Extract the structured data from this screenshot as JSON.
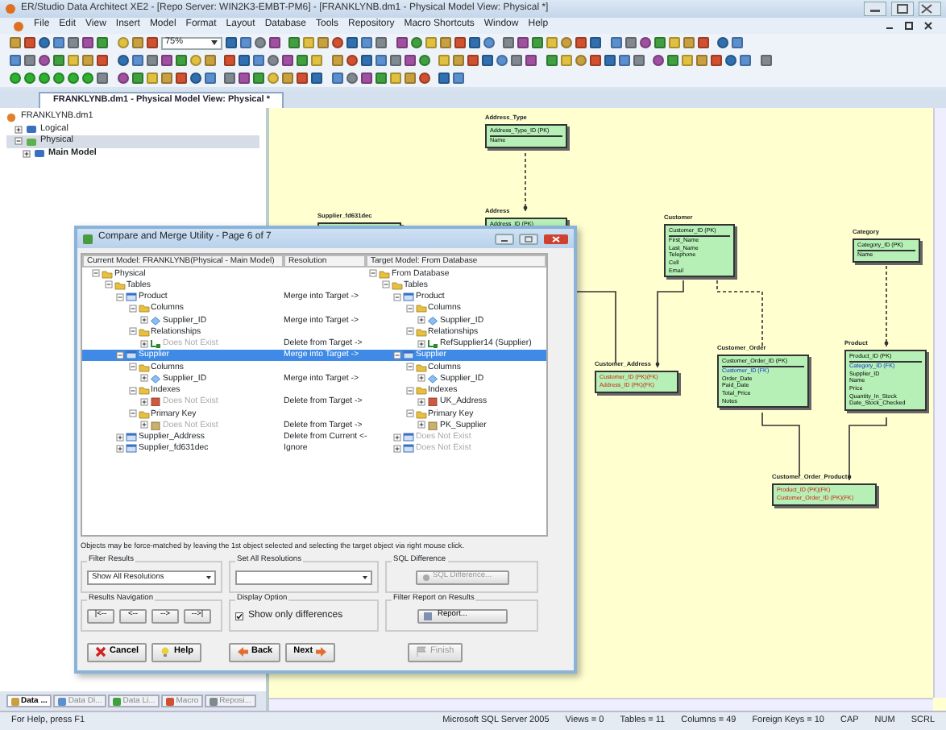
{
  "window": {
    "title": "ER/Studio Data Architect XE2 - [Repo Server: WIN2K3-EMBT-PM6] - [FRANKLYNB.dm1 - Physical Model View: Physical *]"
  },
  "menu": [
    "File",
    "Edit",
    "View",
    "Insert",
    "Model",
    "Format",
    "Layout",
    "Database",
    "Tools",
    "Repository",
    "Macro Shortcuts",
    "Window",
    "Help"
  ],
  "toolbar": {
    "zoom": "75%"
  },
  "document_tab": {
    "label": "FRANKLYNB.dm1 - Physical Model View: Physical *",
    "selected": true
  },
  "explorer": {
    "tree": [
      {
        "label": "FRANKLYNB.dm1",
        "selected": false,
        "children": [
          {
            "label": "Logical",
            "selected": false,
            "expanded": false
          },
          {
            "label": "Physical",
            "selected": true,
            "expanded": true,
            "children": [
              {
                "label": "Main Model",
                "selected": false,
                "expanded": false
              }
            ]
          }
        ]
      }
    ],
    "tabs": [
      {
        "label": "Data ...",
        "selected": true
      },
      {
        "label": "Data Di...",
        "selected": false
      },
      {
        "label": "Data Li...",
        "selected": false
      },
      {
        "label": "Macro",
        "selected": false
      },
      {
        "label": "Reposi...",
        "selected": false
      }
    ]
  },
  "diagram": {
    "entities": [
      {
        "name": "Address_Type",
        "attributes": [
          {
            "label": "Address_Type_ID (PK)",
            "kind": "pk"
          },
          {
            "label": "Name",
            "kind": "plain"
          }
        ]
      },
      {
        "name": "Supplier_fd631dec"
      },
      {
        "name": "Address",
        "attributes": [
          {
            "label": "Address_ID (PK)",
            "kind": "pk"
          }
        ]
      },
      {
        "name": "Customer",
        "attributes": [
          {
            "label": "Customer_ID (PK)",
            "kind": "pk"
          },
          {
            "label": "First_Name",
            "kind": "plain"
          },
          {
            "label": "Last_Name",
            "kind": "plain"
          },
          {
            "label": "Telephone",
            "kind": "plain"
          },
          {
            "label": "Cell",
            "kind": "plain"
          },
          {
            "label": "Email",
            "kind": "plain"
          }
        ]
      },
      {
        "name": "Category",
        "attributes": [
          {
            "label": "Category_ID (PK)",
            "kind": "pk"
          },
          {
            "label": "Name",
            "kind": "plain"
          }
        ]
      },
      {
        "name": "Customer_Address",
        "attributes": [
          {
            "label": "Customer_ID (PK)(FK)",
            "kind": "pkfk"
          },
          {
            "label": "Address_ID (PK)(FK)",
            "kind": "pkfk"
          }
        ]
      },
      {
        "name": "Customer_Order",
        "attributes": [
          {
            "label": "Customer_Order_ID (PK)",
            "kind": "pk"
          },
          {
            "label": "Customer_ID (FK)",
            "kind": "fk"
          },
          {
            "label": "Order_Date",
            "kind": "plain"
          },
          {
            "label": "Paid_Date",
            "kind": "plain"
          },
          {
            "label": "Total_Price",
            "kind": "plain"
          },
          {
            "label": "Notes",
            "kind": "plain"
          }
        ]
      },
      {
        "name": "Product",
        "attributes": [
          {
            "label": "Product_ID (PK)",
            "kind": "pk"
          },
          {
            "label": "Category_ID (FK)",
            "kind": "fk"
          },
          {
            "label": "Supplier_ID",
            "kind": "plain"
          },
          {
            "label": "Name",
            "kind": "plain"
          },
          {
            "label": "Price",
            "kind": "plain"
          },
          {
            "label": "Quantity_In_Stock",
            "kind": "plain"
          },
          {
            "label": "Date_Stock_Checked",
            "kind": "plain"
          }
        ]
      },
      {
        "name": "Customer_Order_Product",
        "attributes": [
          {
            "label": "Product_ID (PK)(FK)",
            "kind": "pkfk"
          },
          {
            "label": "Customer_Order_ID (PK)(FK)",
            "kind": "pkfk"
          }
        ]
      }
    ]
  },
  "dialog": {
    "title": "Compare and Merge Utility - Page 6 of 7",
    "columns": [
      "Current Model: FRANKLYNB(Physical - Main Model)",
      "Resolution",
      "Target Model: From Database"
    ],
    "rows": [
      {
        "current": {
          "label": "Physical",
          "kind": "folder"
        },
        "target": {
          "label": "From Database",
          "kind": "folder"
        },
        "expanded": true,
        "selected": false,
        "children": [
          {
            "current": {
              "label": "Tables",
              "kind": "folder"
            },
            "target": {
              "label": "Tables",
              "kind": "folder"
            },
            "expanded": true,
            "selected": false,
            "children": [
              {
                "current": {
                  "label": "Product",
                  "kind": "table"
                },
                "resolution": "Merge into Target ->",
                "target": {
                  "label": "Product",
                  "kind": "table"
                },
                "expanded": true,
                "selected": false,
                "children": [
                  {
                    "current": {
                      "label": "Columns",
                      "kind": "folder"
                    },
                    "target": {
                      "label": "Columns",
                      "kind": "folder"
                    },
                    "expanded": true,
                    "selected": false,
                    "children": [
                      {
                        "current": {
                          "label": "Supplier_ID",
                          "kind": "column"
                        },
                        "resolution": "Merge into Target ->",
                        "target": {
                          "label": "Supplier_ID",
                          "kind": "column"
                        },
                        "expanded": false,
                        "selected": false
                      }
                    ]
                  },
                  {
                    "current": {
                      "label": "Relationships",
                      "kind": "folder"
                    },
                    "target": {
                      "label": "Relationships",
                      "kind": "folder"
                    },
                    "expanded": true,
                    "selected": false,
                    "children": [
                      {
                        "current": {
                          "label": "Does Not Exist",
                          "kind": "relationship",
                          "absent": true
                        },
                        "resolution": "Delete from Target ->",
                        "target": {
                          "label": "RefSupplier14 (Supplier)",
                          "kind": "relationship"
                        },
                        "expanded": false,
                        "selected": false
                      }
                    ]
                  }
                ]
              },
              {
                "current": {
                  "label": "Supplier",
                  "kind": "table"
                },
                "resolution": "Merge into Target ->",
                "target": {
                  "label": "Supplier",
                  "kind": "table"
                },
                "expanded": true,
                "selected": true,
                "children": [
                  {
                    "current": {
                      "label": "Columns",
                      "kind": "folder"
                    },
                    "target": {
                      "label": "Columns",
                      "kind": "folder"
                    },
                    "expanded": true,
                    "selected": false,
                    "children": [
                      {
                        "current": {
                          "label": "Supplier_ID",
                          "kind": "column"
                        },
                        "resolution": "Merge into Target ->",
                        "target": {
                          "label": "Supplier_ID",
                          "kind": "column"
                        },
                        "expanded": false,
                        "selected": false
                      }
                    ]
                  },
                  {
                    "current": {
                      "label": "Indexes",
                      "kind": "folder"
                    },
                    "target": {
                      "label": "Indexes",
                      "kind": "folder"
                    },
                    "expanded": true,
                    "selected": false,
                    "children": [
                      {
                        "current": {
                          "label": "Does Not Exist",
                          "kind": "index",
                          "absent": true
                        },
                        "resolution": "Delete from Target ->",
                        "target": {
                          "label": "UK_Address",
                          "kind": "index"
                        },
                        "expanded": false,
                        "selected": false
                      }
                    ]
                  },
                  {
                    "current": {
                      "label": "Primary Key",
                      "kind": "folder"
                    },
                    "target": {
                      "label": "Primary Key",
                      "kind": "folder"
                    },
                    "expanded": true,
                    "selected": false,
                    "children": [
                      {
                        "current": {
                          "label": "Does Not Exist",
                          "kind": "key",
                          "absent": true
                        },
                        "resolution": "Delete from Target ->",
                        "target": {
                          "label": "PK_Supplier",
                          "kind": "key"
                        },
                        "expanded": false,
                        "selected": false
                      }
                    ]
                  }
                ]
              },
              {
                "current": {
                  "label": "Supplier_Address",
                  "kind": "table"
                },
                "resolution": "Delete from Current <-",
                "target": {
                  "label": "Does Not Exist",
                  "kind": "table",
                  "absent": true
                },
                "expanded": false,
                "selected": false
              },
              {
                "current": {
                  "label": "Supplier_fd631dec",
                  "kind": "table"
                },
                "resolution": "Ignore",
                "target": {
                  "label": "Does Not Exist",
                  "kind": "table",
                  "absent": true
                },
                "expanded": false,
                "selected": false
              }
            ]
          }
        ]
      }
    ],
    "note": "Objects may be force-matched by leaving the 1st object selected and selecting the target object via right mouse click.",
    "filter_results": {
      "label": "Filter Results",
      "value": "Show All Resolutions"
    },
    "set_all_resolutions": {
      "label": "Set All Resolutions"
    },
    "sql_difference": {
      "label": "SQL Difference",
      "button": "SQL Difference...",
      "disabled": true
    },
    "results_navigation": {
      "label": "Results Navigation",
      "buttons": [
        "|<--",
        "<--",
        "-->",
        "-->|"
      ]
    },
    "display_option": {
      "label": "Display Option",
      "checkbox": "Show only differences",
      "checked": true
    },
    "filter_report": {
      "label": "Filter Report on Results",
      "button": "Report..."
    },
    "buttons": [
      {
        "label": "Cancel",
        "kind": "cancel",
        "disabled": false
      },
      {
        "label": "Help",
        "kind": "help",
        "disabled": false
      },
      {
        "label": "Back",
        "kind": "back",
        "disabled": false
      },
      {
        "label": "Next",
        "kind": "next",
        "disabled": false
      },
      {
        "label": "Finish",
        "kind": "finish",
        "disabled": true
      }
    ]
  },
  "status_bar": [
    "For Help, press F1",
    "Microsoft SQL Server 2005",
    "Views = 0",
    "Tables = 11",
    "Columns = 49",
    "Foreign Keys = 10",
    "CAP",
    "NUM",
    "SCRL"
  ]
}
